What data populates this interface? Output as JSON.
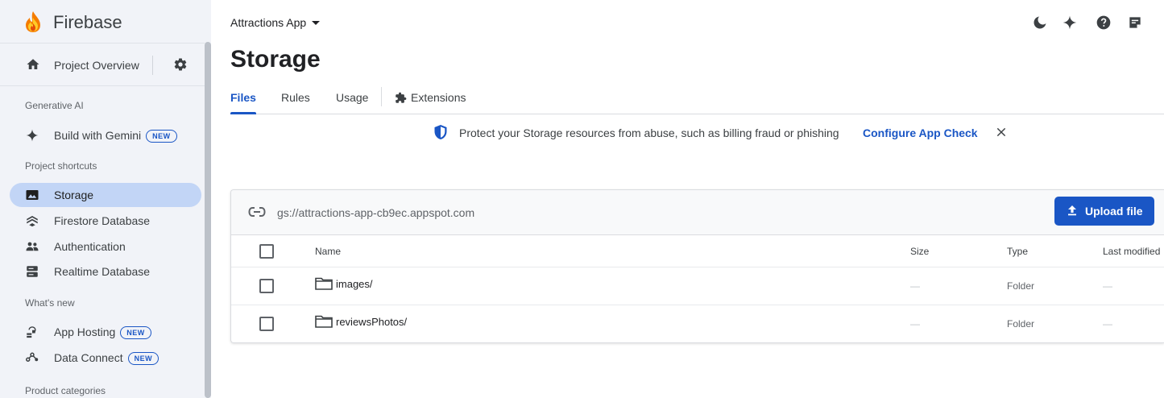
{
  "sidebar": {
    "brand": "Firebase",
    "overview": {
      "label": "Project Overview"
    },
    "sections": {
      "generative_ai": "Generative AI",
      "project_shortcuts": "Project shortcuts",
      "whats_new": "What's new",
      "product_categories": "Product categories"
    },
    "gemini": {
      "label": "Build with Gemini",
      "badge": "NEW"
    },
    "shortcuts": [
      {
        "label": "Storage",
        "icon": "image-icon",
        "active": true
      },
      {
        "label": "Firestore Database",
        "icon": "firestore-icon"
      },
      {
        "label": "Authentication",
        "icon": "people-icon"
      },
      {
        "label": "Realtime Database",
        "icon": "database-icon"
      }
    ],
    "whats_new_items": [
      {
        "label": "App Hosting",
        "badge": "NEW",
        "icon": "app-hosting-icon"
      },
      {
        "label": "Data Connect",
        "badge": "NEW",
        "icon": "data-connect-icon"
      }
    ]
  },
  "header": {
    "project": "Attractions App",
    "title": "Storage",
    "icons": [
      "dark-mode-icon",
      "gemini-sparkle-icon",
      "help-icon",
      "release-notes-icon"
    ]
  },
  "tabs": [
    {
      "label": "Files",
      "active": true
    },
    {
      "label": "Rules"
    },
    {
      "label": "Usage"
    },
    {
      "label": "Extensions",
      "icon": "extensions-icon"
    }
  ],
  "banner": {
    "message": "Protect your Storage resources from abuse, such as billing fraud or phishing",
    "link": "Configure App Check"
  },
  "bucket": {
    "url": "gs://attractions-app-cb9ec.appspot.com",
    "upload_label": "Upload file"
  },
  "table": {
    "columns": {
      "name": "Name",
      "size": "Size",
      "type": "Type",
      "modified": "Last modified"
    },
    "rows": [
      {
        "name": "images/",
        "size": "—",
        "type": "Folder",
        "modified": "—"
      },
      {
        "name": "reviewsPhotos/",
        "size": "—",
        "type": "Folder",
        "modified": "—"
      }
    ]
  },
  "colors": {
    "accent": "#1a56c5",
    "sidebar_bg": "#f1f3f8",
    "active_item_bg": "#c2d5f6"
  }
}
